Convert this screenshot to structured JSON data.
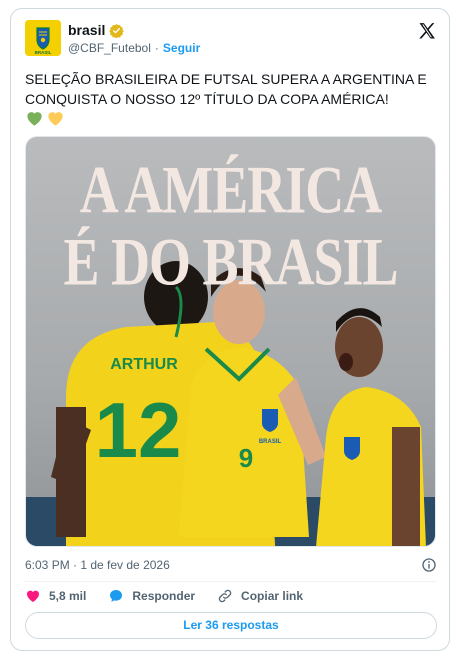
{
  "author": {
    "display_name": "brasil",
    "handle": "@CBF_Futebol",
    "separator": "·",
    "follow_label": "Seguir",
    "avatar_icon": "cbf-crest-icon",
    "verified_icon": "verified-badge-icon",
    "avatar_label": "BRASIL"
  },
  "tweet": {
    "text": "SELEÇÃO BRASILEIRA DE FUTSAL SUPERA A ARGENTINA E CONQUISTA O NOSSO 12º TÍTULO DA COPA AMÉRICA!",
    "emojis": [
      "green-heart-icon",
      "yellow-heart-icon"
    ]
  },
  "media": {
    "headline_line1": "A AMÉRICA",
    "headline_line2": "É DO BRASIL",
    "jersey_name": "ARTHUR",
    "jersey_number_back": "12",
    "jersey_number_front": "9",
    "crest_text": "BRASIL"
  },
  "meta": {
    "timestamp": "6:03 PM · 1 de fev de 2026",
    "info_icon": "info-icon"
  },
  "actions": {
    "likes": "5,8 mil",
    "reply_label": "Responder",
    "copy_label": "Copiar link"
  },
  "replies_button": "Ler 36 respostas",
  "colors": {
    "accent": "#1d9bf0",
    "like": "#f91880",
    "brand_yellow": "#f5d000",
    "text_secondary": "#536471"
  }
}
